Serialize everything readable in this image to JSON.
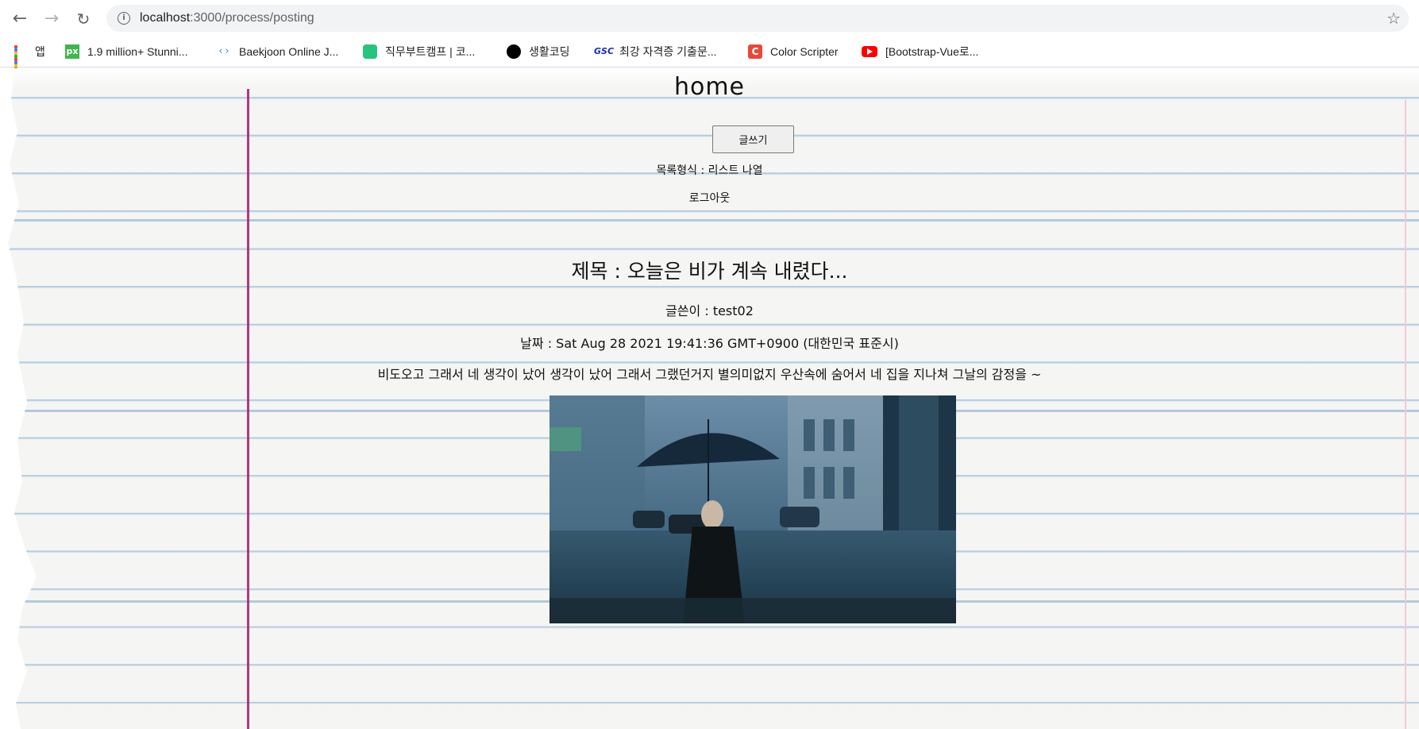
{
  "browser": {
    "url_host": "localhost",
    "url_path": ":3000/process/posting",
    "bookmarks": [
      {
        "label": "앱",
        "icon": "apps-grid-icon"
      },
      {
        "label": "1.9 million+ Stunni...",
        "icon": "pixabay-icon"
      },
      {
        "label": "Baekjoon Online J...",
        "icon": "code-brackets-icon"
      },
      {
        "label": "직무부트캠프 | 코...",
        "icon": "bootcamp-icon"
      },
      {
        "label": "생활코딩",
        "icon": "black-circle-icon"
      },
      {
        "label": "최강 자격증 기출문...",
        "icon": "gsc-icon"
      },
      {
        "label": "Color Scripter",
        "icon": "color-scripter-icon"
      },
      {
        "label": "[Bootstrap-Vue로...",
        "icon": "youtube-icon"
      }
    ]
  },
  "page": {
    "home_title": "home",
    "write_button": "글쓰기",
    "list_link": "목록형식 : 리스트 나열",
    "logout_link": "로그아웃"
  },
  "post": {
    "title": "제목 : 오늘은 비가 계속 내렸다...",
    "author": "글쓴이 : test02",
    "date": "날짜 : Sat Aug 28 2021 19:41:36 GMT+0900 (대한민국 표준시)",
    "body": "비도오고 그래서 네 생각이 났어 생각이 났어 그래서 그랬던거지 별의미없지 우산속에 숨어서 네 집을 지나쳐 그날의 감정을 ~"
  },
  "colors": {
    "margin_line": "#b0236a",
    "rule_line": "#a3bfd6"
  }
}
